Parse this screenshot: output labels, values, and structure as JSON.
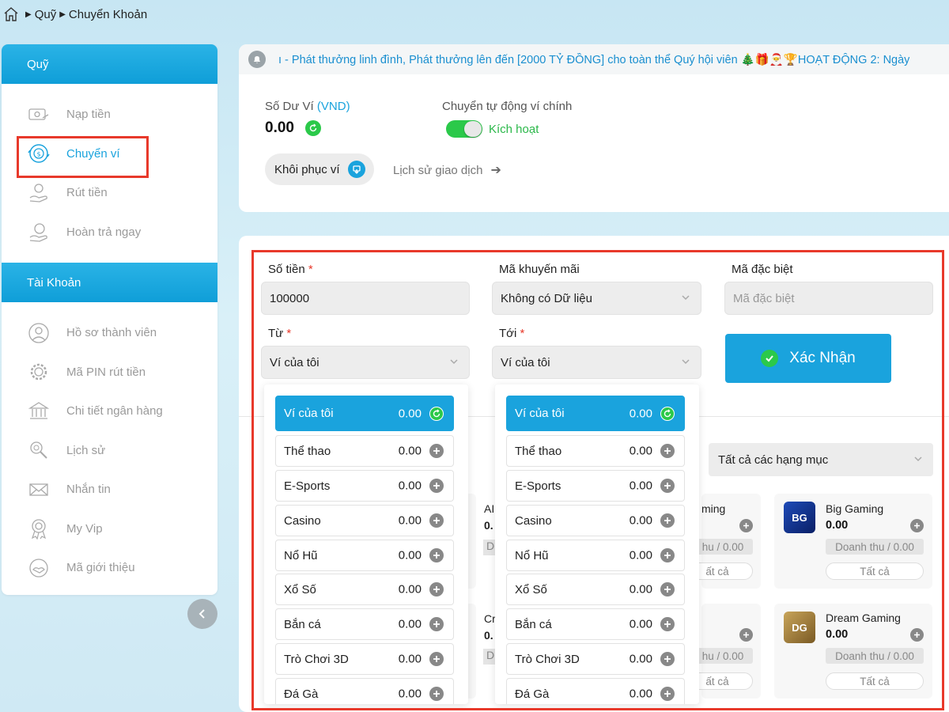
{
  "breadcrumb": {
    "items": [
      "Quỹ",
      "Chuyển Khoản"
    ]
  },
  "sidebar": {
    "section1_title": "Quỹ",
    "section1_items": [
      {
        "label": "Nạp tiền",
        "icon": "deposit-icon"
      },
      {
        "label": "Chuyển ví",
        "icon": "wallet-transfer-icon",
        "active": true
      },
      {
        "label": "Rút tiền",
        "icon": "withdraw-icon"
      },
      {
        "label": "Hoàn trả ngay",
        "icon": "refund-icon"
      }
    ],
    "section2_title": "Tài Khoản",
    "section2_items": [
      {
        "label": "Hồ sơ thành viên",
        "icon": "user-icon"
      },
      {
        "label": "Mã PIN rút tiền",
        "icon": "pin-gear-icon"
      },
      {
        "label": "Chi tiết ngân hàng",
        "icon": "bank-icon"
      },
      {
        "label": "Lịch sử",
        "icon": "history-search-icon"
      },
      {
        "label": "Nhắn tin",
        "icon": "mail-icon"
      },
      {
        "label": "My Vip",
        "icon": "vip-badge-icon"
      },
      {
        "label": "Mã giới thiệu",
        "icon": "referral-icon"
      }
    ]
  },
  "announcement": "ı - Phát thưởng linh đình, Phát thưởng lên đến [2000 TỶ ĐỒNG] cho toàn thể Quý hội viên 🎄🎁🎅🏆HOẠT ĐỘNG 2: Ngày",
  "wallet": {
    "balance_label": "Số Dư Ví",
    "balance_unit": "(VND)",
    "balance_value": "0.00",
    "auto_label": "Chuyển tự động ví chính",
    "toggle_text": "Kích hoạt",
    "restore_label": "Khôi phục ví",
    "history_label": "Lịch sử giao dịch"
  },
  "form": {
    "amount_label": "Số tiền",
    "amount_value": "100000",
    "promo_label": "Mã khuyến mãi",
    "promo_value": "Không có Dữ liệu",
    "special_label": "Mã đặc biệt",
    "special_placeholder": "Mã đặc biệt",
    "from_label": "Từ",
    "from_value": "Ví của tôi",
    "to_label": "Tới",
    "to_value": "Ví của tôi",
    "required_mark": "*",
    "confirm_label": "Xác Nhận"
  },
  "wallet_options": [
    {
      "name": "Ví của tôi",
      "amount": "0.00"
    },
    {
      "name": "Thể thao",
      "amount": "0.00"
    },
    {
      "name": "E-Sports",
      "amount": "0.00"
    },
    {
      "name": "Casino",
      "amount": "0.00"
    },
    {
      "name": "Nổ Hũ",
      "amount": "0.00"
    },
    {
      "name": "Xổ Số",
      "amount": "0.00"
    },
    {
      "name": "Bắn cá",
      "amount": "0.00"
    },
    {
      "name": "Trò Chơi 3D",
      "amount": "0.00"
    },
    {
      "name": "Đá Gà",
      "amount": "0.00"
    }
  ],
  "category_select": "Tất cả các hạng mục",
  "providers": [
    {
      "name": "Big Gaming",
      "value": "0.00",
      "revenue": "Doanh thu / 0.00",
      "all": "Tất cả",
      "logo": "BG"
    },
    {
      "name": "Dream Gaming",
      "value": "0.00",
      "revenue": "Doanh thu / 0.00",
      "all": "Tất cả",
      "logo": "DG"
    }
  ],
  "partial_providers": {
    "col1_top_name": "AI",
    "col1_top_value": "0.",
    "col1_top_rev": "D",
    "col1_bottom_name": "Cr",
    "col1_bottom_value": "0.",
    "col1_bottom_rev": "D",
    "col2_top_name": "ming",
    "col2_top_rev": "hu / 0.00",
    "col2_top_all": "ất cả",
    "col2_bottom_rev": "hu / 0.00",
    "col2_bottom_all": "ất cả"
  },
  "colors": {
    "accent": "#1aa3dd",
    "success": "#2bc94a",
    "highlight": "#e8392b"
  }
}
